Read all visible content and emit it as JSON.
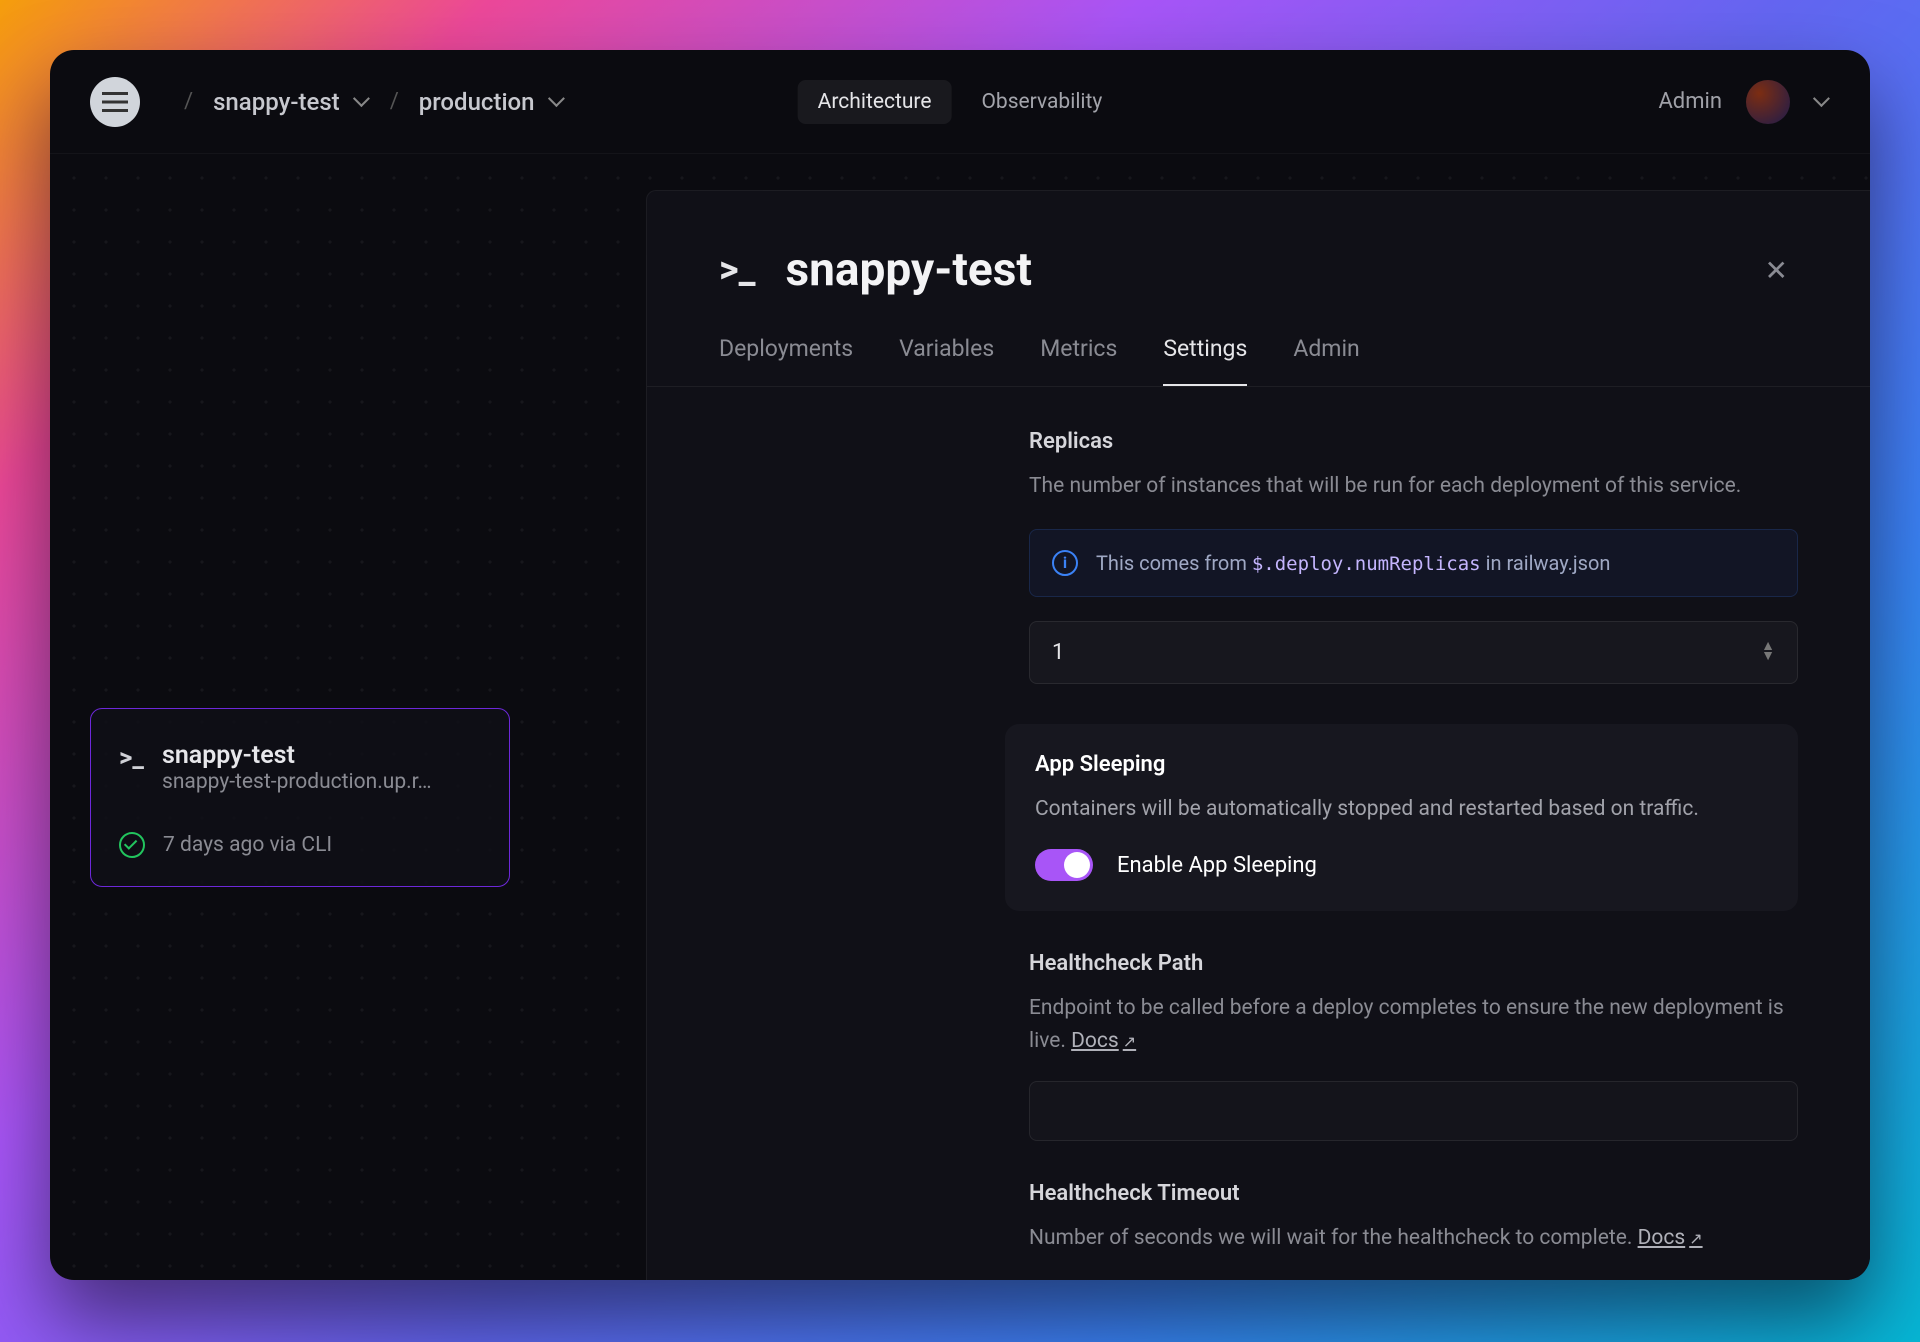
{
  "breadcrumbs": {
    "project": "snappy-test",
    "environment": "production"
  },
  "header_nav": {
    "architecture": "Architecture",
    "observability": "Observability"
  },
  "header_right": {
    "admin": "Admin"
  },
  "service_card": {
    "name": "snappy-test",
    "url": "snappy-test-production.up.r…",
    "status": "7 days ago via CLI"
  },
  "panel": {
    "title": "snappy-test",
    "tabs": {
      "deployments": "Deployments",
      "variables": "Variables",
      "metrics": "Metrics",
      "settings": "Settings",
      "admin": "Admin"
    },
    "replicas": {
      "title": "Replicas",
      "desc": "The number of instances that will be run for each deployment of this service.",
      "info_pre": "This comes from ",
      "info_code": "$.deploy.numReplicas",
      "info_post": " in railway.json",
      "value": "1"
    },
    "app_sleeping": {
      "title": "App Sleeping",
      "desc": "Containers will be automatically stopped and restarted based on traffic.",
      "toggle_label": "Enable App Sleeping",
      "enabled": true
    },
    "healthcheck_path": {
      "title": "Healthcheck Path",
      "desc": "Endpoint to be called before a deploy completes to ensure the new deployment is live. ",
      "docs": "Docs"
    },
    "healthcheck_timeout": {
      "title": "Healthcheck Timeout",
      "desc": "Number of seconds we will wait for the healthcheck to complete. ",
      "docs": "Docs"
    }
  }
}
